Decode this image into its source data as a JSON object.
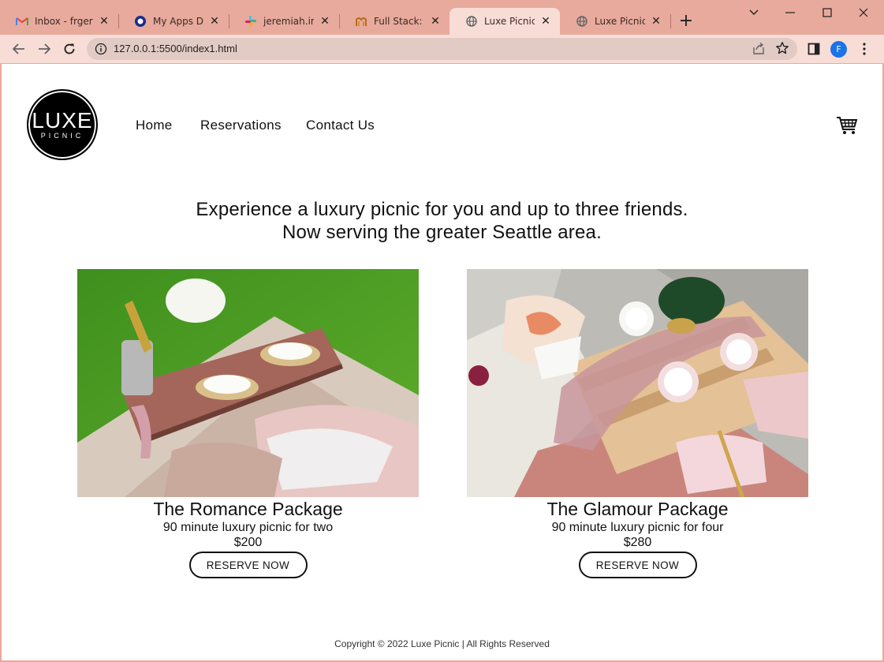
{
  "browser": {
    "tabs": [
      {
        "title": "Inbox - frgero",
        "icon": "gmail-icon"
      },
      {
        "title": "My Apps Dash",
        "icon": "okta-icon"
      },
      {
        "title": "jeremiah.iro -",
        "icon": "slack-icon"
      },
      {
        "title": "Full Stack: HTM",
        "icon": "course-icon"
      },
      {
        "title": "Luxe Picnic",
        "icon": "globe-icon",
        "active": true
      },
      {
        "title": "Luxe Picnic",
        "icon": "globe-icon"
      }
    ],
    "url": "127.0.0.1:5500/index1.html",
    "profile_initial": "F"
  },
  "site": {
    "logo": {
      "big": "LUXE",
      "small": "PICNIC"
    },
    "nav": [
      "Home",
      "Reservations",
      "Contact Us"
    ],
    "headline": {
      "line1": "Experience a luxury picnic for you and up to three friends.",
      "line2": "Now serving the greater Seattle area."
    },
    "packages": [
      {
        "name": "The Romance Package",
        "desc": "90 minute luxury picnic for two",
        "price": "$200",
        "button": "RESERVE NOW"
      },
      {
        "name": "The Glamour Package",
        "desc": "90 minute luxury picnic for four",
        "price": "$280",
        "button": "RESERVE NOW"
      }
    ],
    "footer": "Copyright © 2022 Luxe Picnic | All Rights Reserved"
  },
  "colors": {
    "tabstrip": "#e7aa9c",
    "toolbar": "#f8ddd6",
    "accent": "#111111"
  }
}
